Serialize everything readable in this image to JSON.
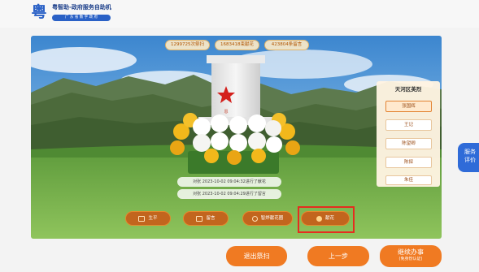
{
  "header": {
    "logo_char": "粤",
    "title": "粤智助-政府服务自助机",
    "tagline": "广 东 省 数 字 政 府"
  },
  "memorial": {
    "stats": [
      "1299725次祭扫",
      "1683418束献花",
      "423804条留言"
    ],
    "plaque_char": "恩",
    "records": [
      "对张 2023-10-02 09:04:32进行了献花",
      "对张 2023-10-02 09:04:29进行了留言"
    ]
  },
  "actions": [
    {
      "label": "生平",
      "icon": "document-icon"
    },
    {
      "label": "留言",
      "icon": "message-icon"
    },
    {
      "label": "智烨献花圈",
      "icon": "person-icon"
    },
    {
      "label": "献花",
      "icon": "flower-icon"
    }
  ],
  "martyr_panel": {
    "title": "天河区英烈",
    "items": [
      "张国辉",
      "王记",
      "陈望卿",
      "陈探",
      "朱佳"
    ],
    "active_index": 0
  },
  "service_rating": {
    "line1": "服务",
    "line2": "评价"
  },
  "footer": {
    "exit_label": "退出祭扫",
    "prev_label": "上一步",
    "continue_label": "继续办事",
    "continue_sub": "(免身份认证)"
  },
  "colors": {
    "accent": "#f07a22",
    "brand_blue": "#2f6bd8",
    "highlight": "#e52d1f"
  }
}
